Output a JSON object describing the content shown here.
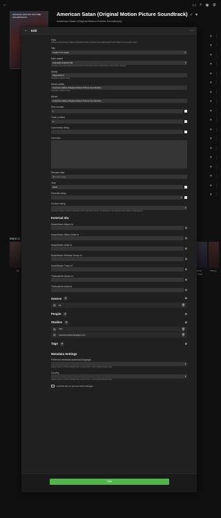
{
  "background": {
    "poster_text": "ORIGINAL MOTION PICTURE SOUNDTRACK",
    "title": "American Satan (Original Motion Picture Soundtrack)",
    "title_mark": "✓",
    "subtitle": "American Satan (Original Motion Picture Soundtrack)",
    "more_like": "More Li",
    "thumb_labels": [
      "Fe",
      "Rock",
      "Pearl",
      "Thorny"
    ]
  },
  "dialog": {
    "title": "Edit",
    "path_label": "Path",
    "path_value": "/Volumes/American Satan (Original Motion Picture Soundtrack)/07-04 Freak On A Leash.mp3",
    "title_label": "Title",
    "title_value": "Freak On A Leash",
    "date_added_label": "Date added",
    "date_added_value": "3/11/2019 8:39:04 PM",
    "date_added_help": "Configure how date added is determined in the Emby Server dashboard under Library settings",
    "artists_label": "Artists",
    "artists_value": "Papa Roach",
    "artists_help": "Separate multiple using ;",
    "album_artists_label": "Album artists",
    "album_artists_value": "American Satan (Original Motion Picture Soundtrack)",
    "album_artists_help": "Separate multiple using ;",
    "album_label": "Album",
    "album_value": "American Satan (Original Motion Picture Soundtrack)",
    "disc_label": "Disc number",
    "disc_value": "1",
    "track_label": "Track number",
    "track_value": "4",
    "community_label": "Community rating",
    "community_value": "",
    "overview_label": "Overview",
    "release_label": "Release date",
    "release_value": "",
    "release_placeholder": "dd / mm / yyyy",
    "year_label": "Year",
    "year_value": "2019",
    "parental_label": "Parental rating",
    "parental_value": "",
    "custom_label": "Custom rating",
    "custom_value": "",
    "custom_help": "A custom rating is used for parental control restrictions but is not displayed. The parental rating field is still displayed.",
    "external_ids_title": "External Ids:",
    "external_ids": [
      {
        "label": "MusicBrainz Album Id",
        "value": ""
      },
      {
        "label": "MusicBrainz Album Artist Id",
        "value": ""
      },
      {
        "label": "MusicBrainz Artist Id",
        "value": ""
      },
      {
        "label": "MusicBrainz Release Group Id",
        "value": ""
      },
      {
        "label": "MusicBrainz Track Id",
        "value": ""
      },
      {
        "label": "TheAudioDb Album Id",
        "value": ""
      },
      {
        "label": "TheAudioDb Artist Id",
        "value": ""
      }
    ],
    "genres_title": "Genres",
    "genres": [
      "Alt"
    ],
    "people_title": "People",
    "studios_title": "Studios",
    "studios": [
      "Vlex",
      "marinusmusica.blogspot.com"
    ],
    "tags_title": "Tags",
    "metadata_title": "Metadata Settings",
    "pref_lang_label": "Preferred metadata download language",
    "pref_lang_value": "",
    "pref_lang_help": "Leave empty to inherit settings from a parent item, or the global default value.",
    "country_label": "Country",
    "country_value": "",
    "country_help": "Leave empty to inherit settings from a parent item, or the global default value.",
    "lock_label": "Lock this item to prevent future changes",
    "save_label": "Save"
  }
}
